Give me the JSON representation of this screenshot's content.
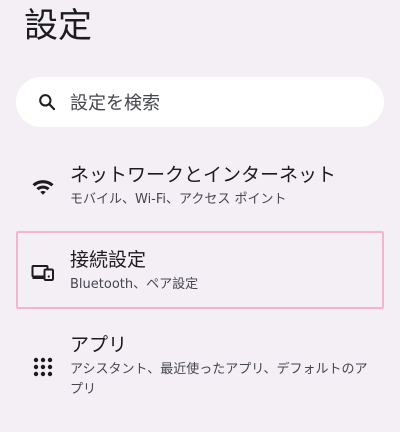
{
  "header": {
    "title": "設定"
  },
  "search": {
    "placeholder": "設定を検索",
    "icon": "search-icon"
  },
  "colors": {
    "background": "#f3eff5",
    "surface": "#ffffff",
    "highlight_border": "#f3b6cf"
  },
  "settings_items": [
    {
      "title": "ネットワークとインターネット",
      "summary": "モバイル、Wi-Fi、アクセス ポイント",
      "icon": "wifi-icon",
      "selected": false
    },
    {
      "title": "接続設定",
      "summary": "Bluetooth、ペア設定",
      "icon": "connected-devices-icon",
      "selected": true
    },
    {
      "title": "アプリ",
      "summary": "アシスタント、最近使ったアプリ、デフォルトのアプリ",
      "icon": "apps-grid-icon",
      "selected": false
    }
  ]
}
